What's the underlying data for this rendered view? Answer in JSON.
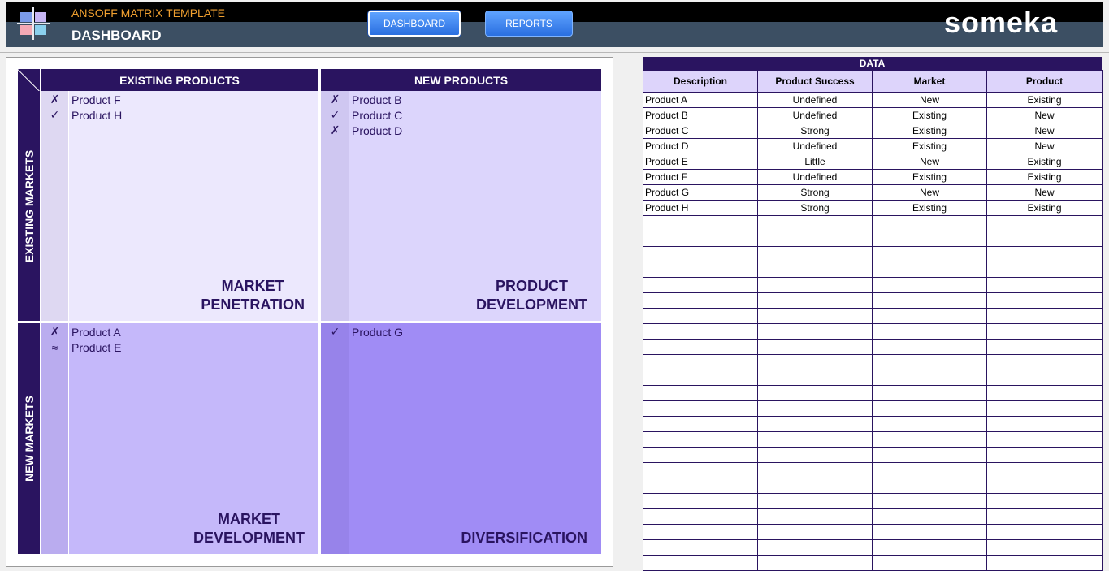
{
  "header": {
    "app_title": "ANSOFF MATRIX TEMPLATE",
    "page_title": "DASHBOARD",
    "brand": "someka"
  },
  "nav": {
    "dashboard": "DASHBOARD",
    "reports": "REPORTS"
  },
  "matrix": {
    "col_headers": [
      "EXISTING PRODUCTS",
      "NEW PRODUCTS"
    ],
    "row_headers": [
      "EXISTING MARKETS",
      "NEW MARKETS"
    ],
    "quadrants": [
      {
        "title": [
          "MARKET",
          "PENETRATION"
        ],
        "color": "#ece8fd",
        "items": [
          {
            "icon": "✗",
            "name": "Product F"
          },
          {
            "icon": "✓",
            "name": "Product H"
          }
        ]
      },
      {
        "title": [
          "PRODUCT",
          "DEVELOPMENT"
        ],
        "color": "#dcd5fc",
        "items": [
          {
            "icon": "✗",
            "name": "Product B"
          },
          {
            "icon": "✓",
            "name": "Product C"
          },
          {
            "icon": "✗",
            "name": "Product D"
          }
        ]
      },
      {
        "title": [
          "MARKET",
          "DEVELOPMENT"
        ],
        "color": "#c5b8fa",
        "items": [
          {
            "icon": "✗",
            "name": "Product A"
          },
          {
            "icon": "≈",
            "name": "Product E"
          }
        ]
      },
      {
        "title": [
          "DIVERSIFICATION"
        ],
        "color": "#a08cf5",
        "items": [
          {
            "icon": "✓",
            "name": "Product G"
          }
        ]
      }
    ]
  },
  "data_table": {
    "title": "DATA",
    "headers": [
      "Description",
      "Product Success",
      "Market",
      "Product"
    ],
    "rows": [
      [
        "Product A",
        "Undefined",
        "New",
        "Existing"
      ],
      [
        "Product B",
        "Undefined",
        "Existing",
        "New"
      ],
      [
        "Product C",
        "Strong",
        "Existing",
        "New"
      ],
      [
        "Product D",
        "Undefined",
        "Existing",
        "New"
      ],
      [
        "Product E",
        "Little",
        "New",
        "Existing"
      ],
      [
        "Product F",
        "Undefined",
        "Existing",
        "Existing"
      ],
      [
        "Product G",
        "Strong",
        "New",
        "New"
      ],
      [
        "Product H",
        "Strong",
        "Existing",
        "Existing"
      ]
    ],
    "empty_rows": 23
  }
}
